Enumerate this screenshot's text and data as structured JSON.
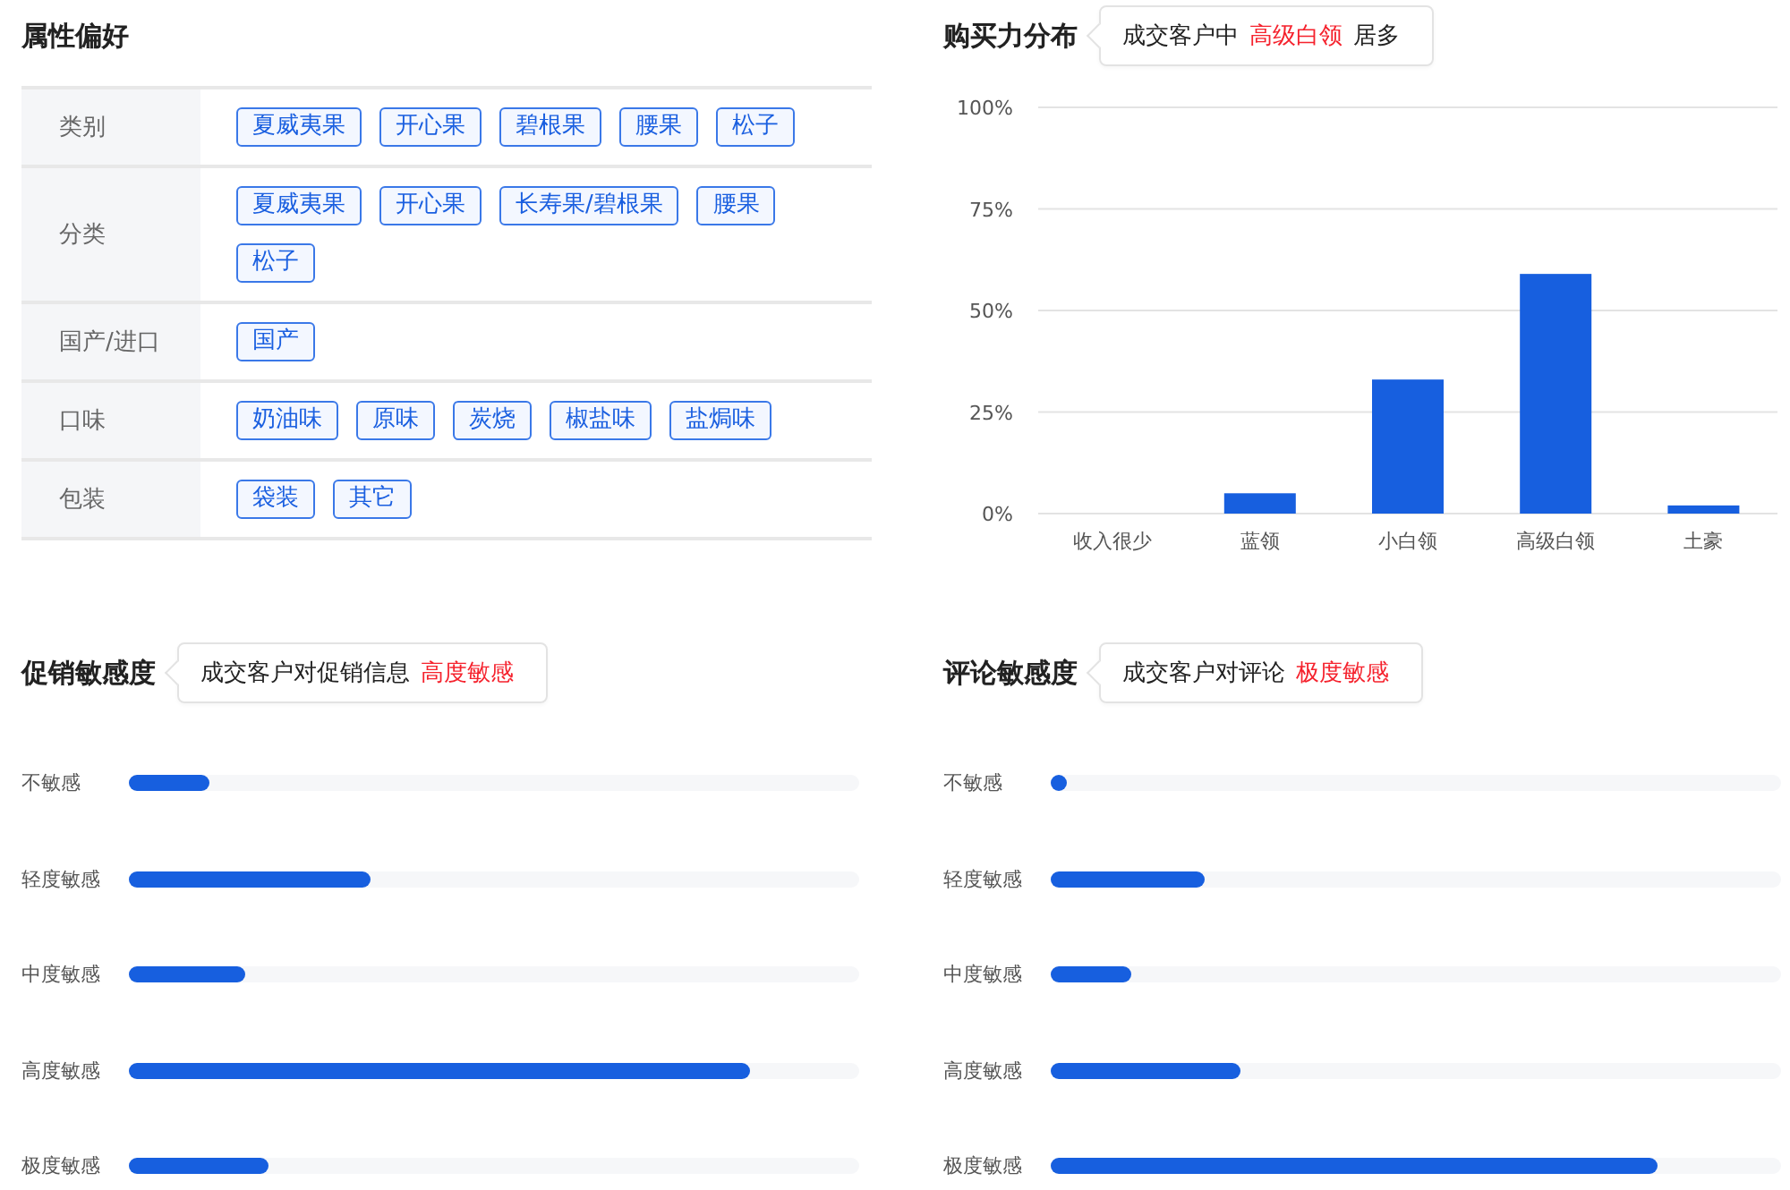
{
  "attribute_preferences": {
    "title": "属性偏好",
    "rows": [
      {
        "label": "类别",
        "tags": [
          "夏威夷果",
          "开心果",
          "碧根果",
          "腰果",
          "松子"
        ]
      },
      {
        "label": "分类",
        "tags": [
          "夏威夷果",
          "开心果",
          "长寿果/碧根果",
          "腰果",
          "松子"
        ]
      },
      {
        "label": "国产/进口",
        "tags": [
          "国产"
        ]
      },
      {
        "label": "口味",
        "tags": [
          "奶油味",
          "原味",
          "炭烧",
          "椒盐味",
          "盐焗味"
        ]
      },
      {
        "label": "包装",
        "tags": [
          "袋装",
          "其它"
        ]
      }
    ]
  },
  "purchasing_power": {
    "title": "购买力分布",
    "callout": {
      "prefix": "成交客户中",
      "highlight": "高级白领",
      "suffix": "居多"
    },
    "chart_data": {
      "type": "bar",
      "grid": true,
      "categories": [
        "收入很少",
        "蓝领",
        "小白领",
        "高级白领",
        "土豪"
      ],
      "values": [
        0,
        5,
        33,
        59,
        2
      ],
      "ylim": [
        0,
        100
      ],
      "yticks": [
        {
          "value": 0,
          "label": "0%"
        },
        {
          "value": 25,
          "label": "25%"
        },
        {
          "value": 50,
          "label": "50%"
        },
        {
          "value": 75,
          "label": "75%"
        },
        {
          "value": 100,
          "label": "100%"
        }
      ]
    }
  },
  "promotion_sensitivity": {
    "title": "促销敏感度",
    "callout": {
      "prefix": "成交客户对促销信息",
      "highlight": "高度敏感"
    },
    "bars": [
      {
        "label": "不敏感",
        "level": 0.11
      },
      {
        "label": "轻度敏感",
        "level": 0.33
      },
      {
        "label": "中度敏感",
        "level": 0.16
      },
      {
        "label": "高度敏感",
        "level": 0.85
      },
      {
        "label": "极度敏感",
        "level": 0.19
      }
    ]
  },
  "review_sensitivity": {
    "title": "评论敏感度",
    "callout": {
      "prefix": "成交客户对评论",
      "highlight": "极度敏感"
    },
    "bars": [
      {
        "label": "不敏感",
        "level": 0.02
      },
      {
        "label": "轻度敏感",
        "level": 0.21
      },
      {
        "label": "中度敏感",
        "level": 0.11
      },
      {
        "label": "高度敏感",
        "level": 0.26
      },
      {
        "label": "极度敏感",
        "level": 0.83
      }
    ]
  }
}
